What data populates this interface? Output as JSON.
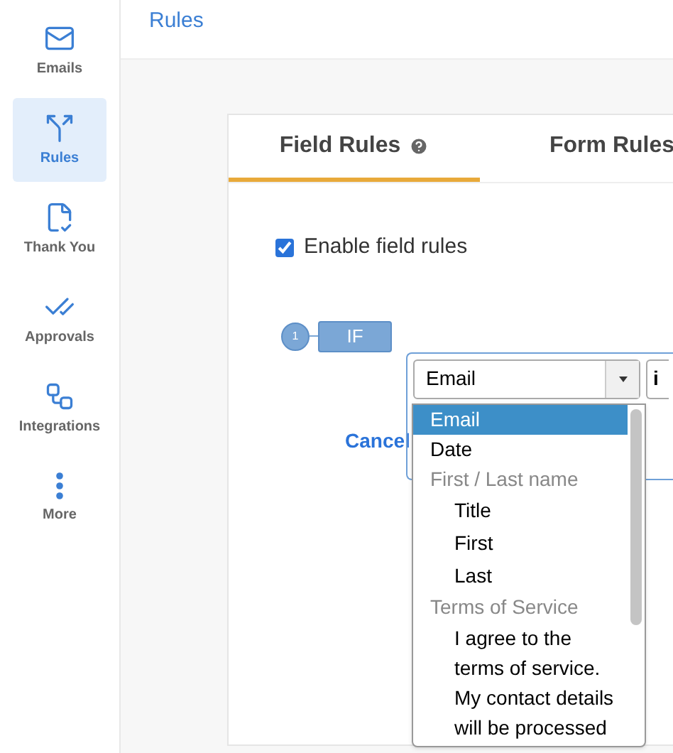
{
  "sidebar": {
    "items": [
      {
        "label": "Emails",
        "selected": false
      },
      {
        "label": "Rules",
        "selected": true
      },
      {
        "label": "Thank You",
        "selected": false
      },
      {
        "label": "Approvals",
        "selected": false
      },
      {
        "label": "Integrations",
        "selected": false
      },
      {
        "label": "More",
        "selected": false
      }
    ]
  },
  "header": {
    "title": "Rules"
  },
  "tabs": [
    {
      "label": "Field Rules",
      "selected": true,
      "help": true
    },
    {
      "label": "Form Rules",
      "selected": false,
      "help": false
    }
  ],
  "enable_checkbox": {
    "label": "Enable field rules",
    "checked": true
  },
  "rule": {
    "number": "1",
    "keyword": "IF",
    "field_select": {
      "value": "Email"
    },
    "operator_select": {
      "value": "i"
    },
    "cancel": "Cancel",
    "dropdown": {
      "options": [
        {
          "label": "Email",
          "selected": true
        },
        {
          "label": "Date",
          "selected": false
        },
        {
          "group": "First / Last name",
          "children": [
            {
              "label": "Title",
              "selected": false
            },
            {
              "label": "First",
              "selected": false
            },
            {
              "label": "Last",
              "selected": false
            }
          ]
        },
        {
          "group": "Terms of Service",
          "children": [
            {
              "label": "I agree to the terms of service. My contact details will be processed",
              "selected": false
            }
          ]
        }
      ]
    }
  }
}
